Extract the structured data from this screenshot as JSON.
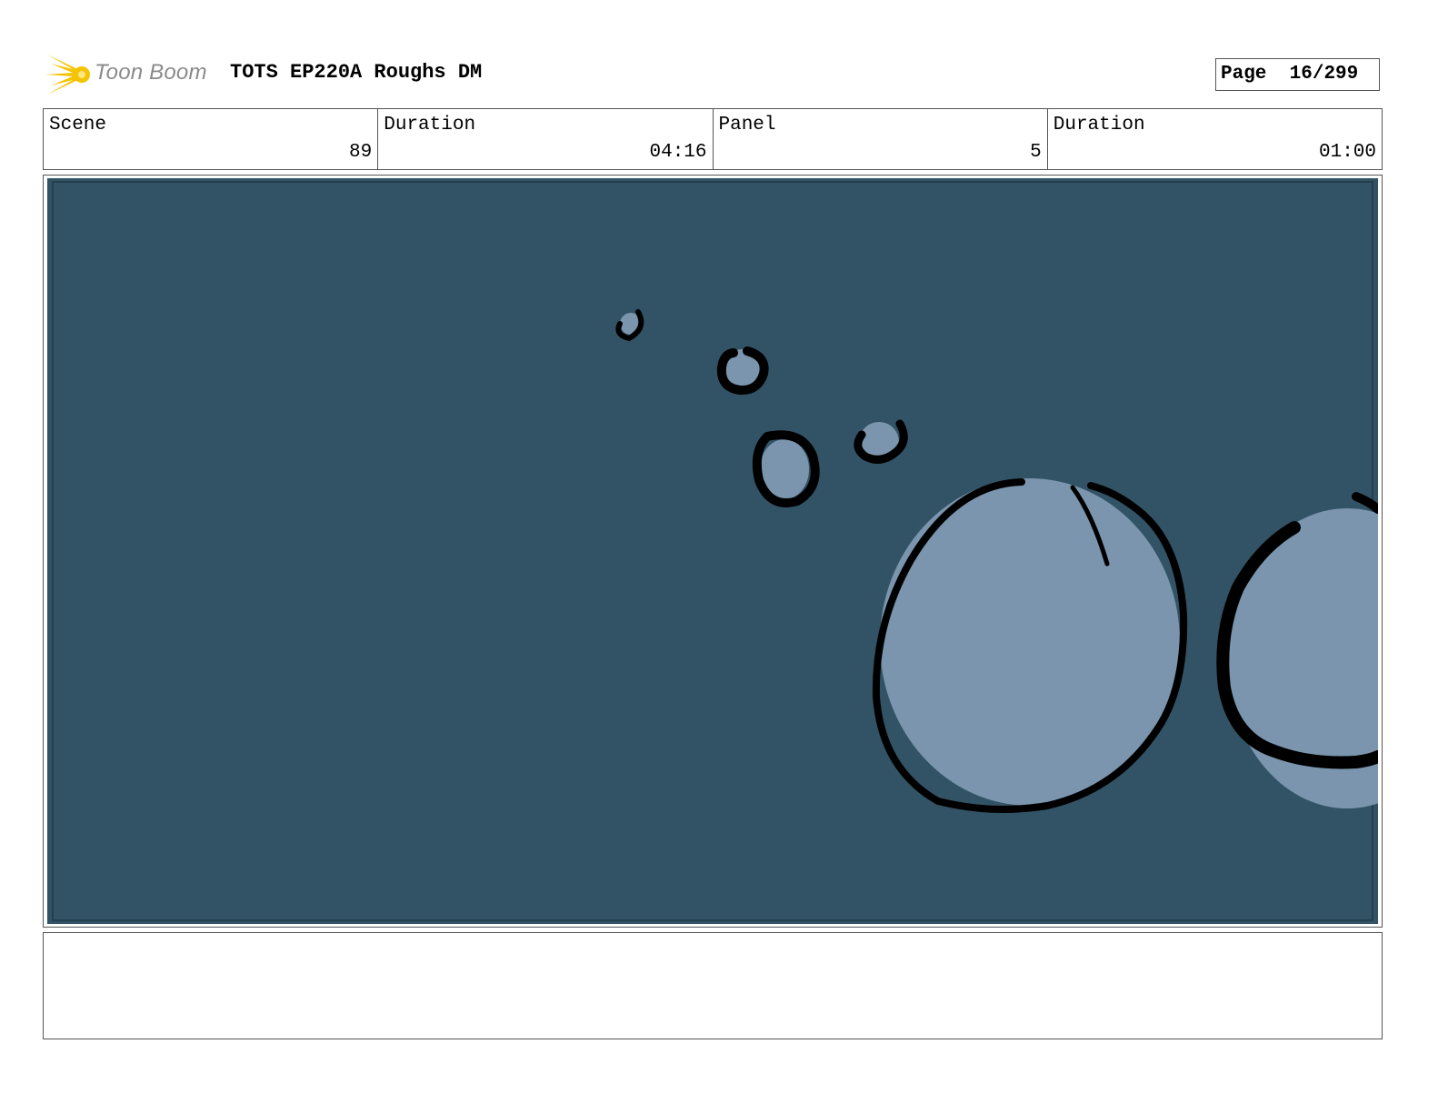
{
  "header": {
    "logo_text": "Toon Boom",
    "title": "TOTS EP220A Roughs DM",
    "page_label": "Page",
    "page_number": "16/299"
  },
  "info": {
    "scene_label": "Scene",
    "scene_value": "89",
    "scene_duration_label": "Duration",
    "scene_duration_value": "04:16",
    "panel_label": "Panel",
    "panel_value": "5",
    "panel_duration_label": "Duration",
    "panel_duration_value": "01:00"
  },
  "colors": {
    "panel_background": "#325366",
    "bubble_fill": "#7a95ad",
    "ink": "#000000",
    "logo_yellow": "#f5c400",
    "logo_text": "#8a8a8a",
    "border": "#555555"
  },
  "icons": {
    "logo": "toon-boom-starburst-icon"
  },
  "notes": {
    "text": ""
  }
}
